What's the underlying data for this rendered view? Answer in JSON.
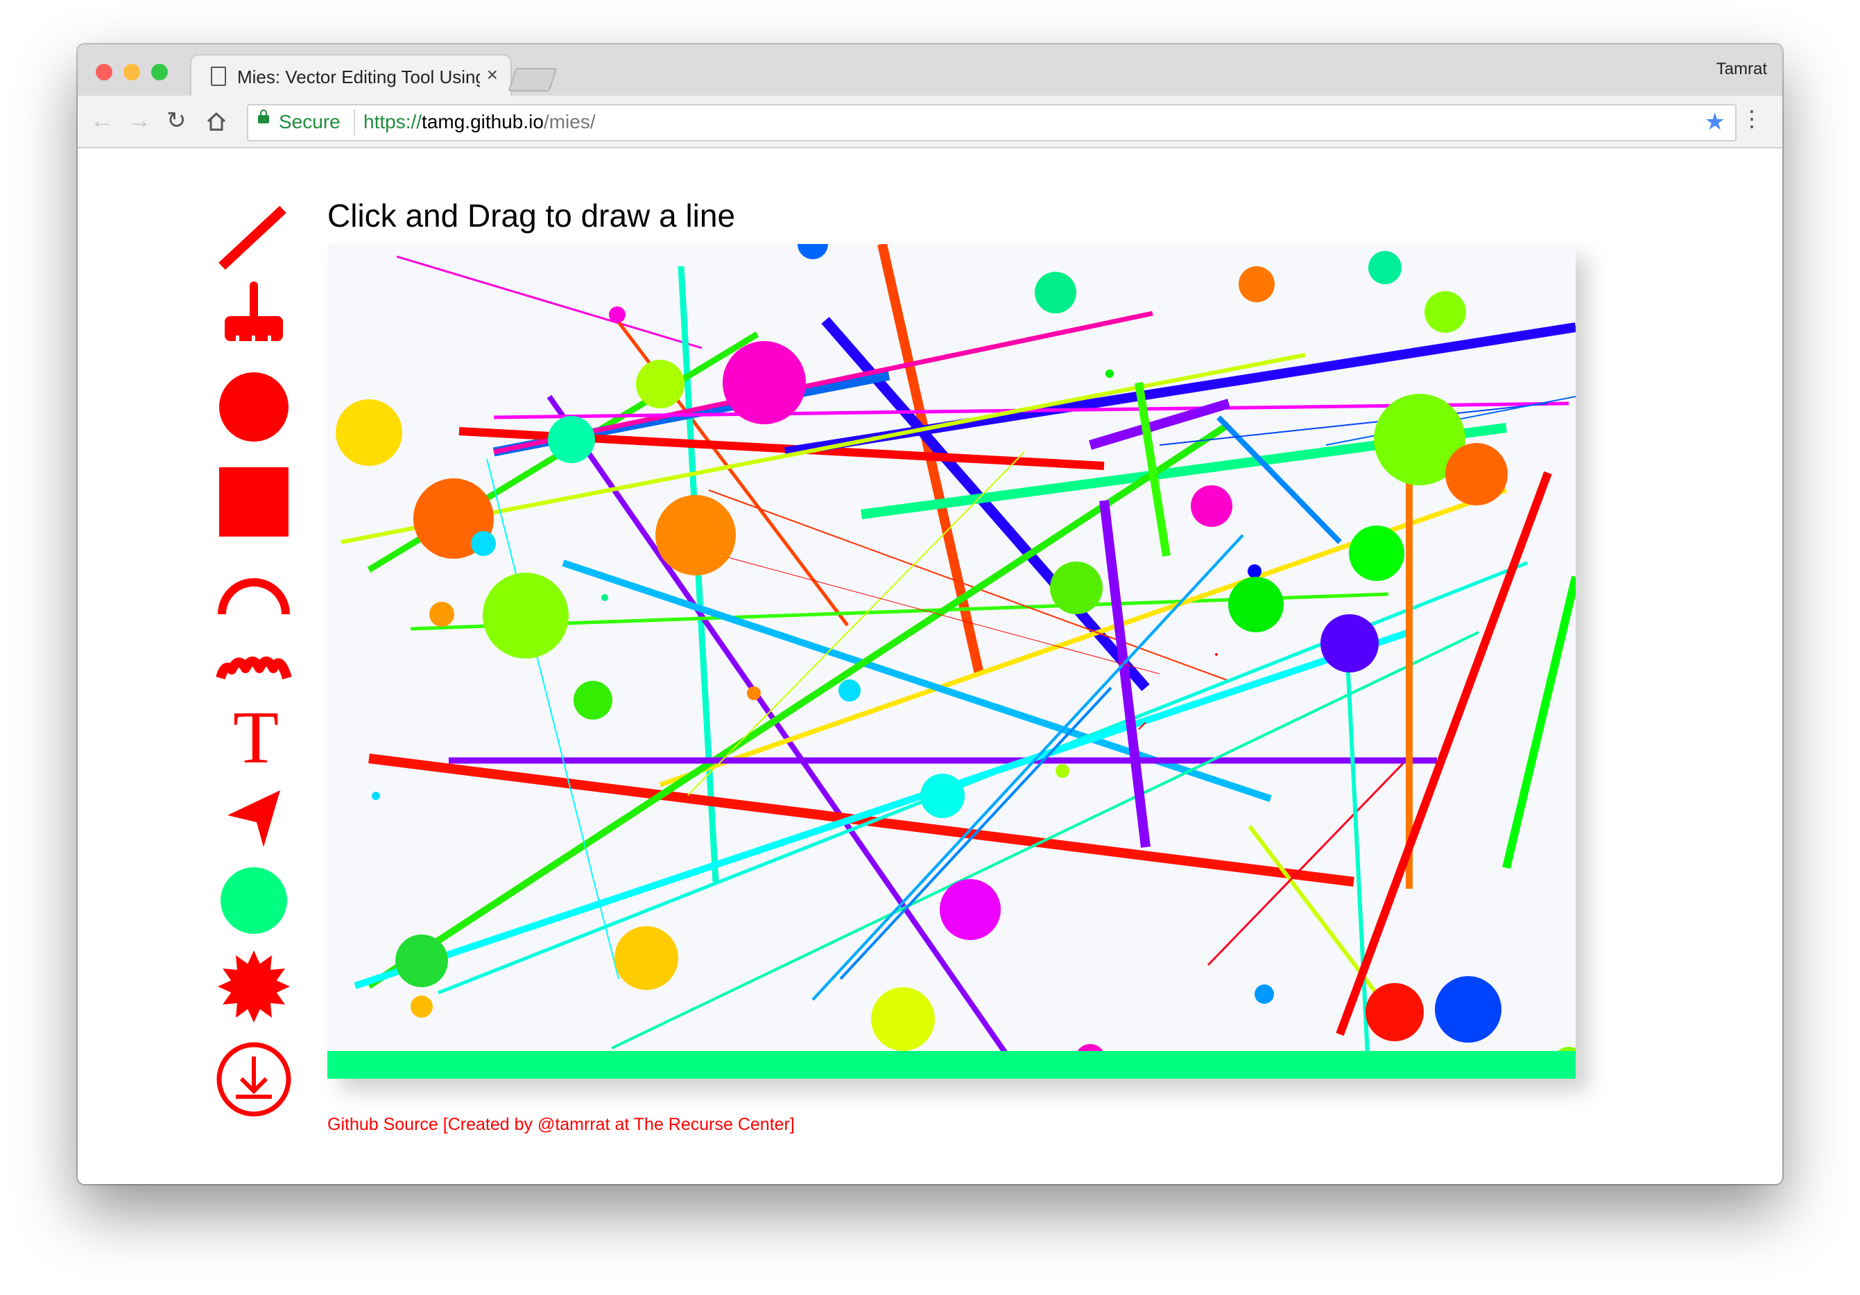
{
  "browser": {
    "tab_title": "Mies: Vector Editing Tool Using",
    "tab_close": "×",
    "user": "Tamrat",
    "secure_label": "Secure",
    "url_scheme": "https://",
    "url_host": "tamg.github.io",
    "url_path": "/mies/"
  },
  "icons": {
    "back": "back-arrow-icon",
    "forward": "forward-arrow-icon",
    "reload": "reload-icon",
    "home": "home-icon",
    "lock": "lock-icon",
    "bookmark": "star-icon",
    "menu": "three-dots-icon"
  },
  "tools": [
    {
      "name": "line-tool",
      "icon": "line-icon"
    },
    {
      "name": "brush-tool",
      "icon": "brush-icon"
    },
    {
      "name": "circle-tool",
      "icon": "circle-icon"
    },
    {
      "name": "rectangle-tool",
      "icon": "square-icon"
    },
    {
      "name": "arc-tool",
      "icon": "arc-icon"
    },
    {
      "name": "wave-tool",
      "icon": "squiggle-icon"
    },
    {
      "name": "text-tool",
      "icon": "text-icon",
      "label": "T"
    },
    {
      "name": "select-tool",
      "icon": "arrow-pointer-icon"
    },
    {
      "name": "fill-color-tool",
      "icon": "filled-circle-icon"
    },
    {
      "name": "random-tool",
      "icon": "starburst-icon"
    },
    {
      "name": "download-tool",
      "icon": "download-icon"
    }
  ],
  "colors": {
    "tool": "#ff0000",
    "fill_swatch": "#00ff80",
    "bottom_bar": "#00ff80",
    "canvas_bg": "#f7f8fc",
    "secure": "#1e8e3e",
    "url_host": "#1e8e3e"
  },
  "main": {
    "instruction": "Click and Drag to draw a line",
    "footer": "Github Source [Created by @tamrrat at The Recurse Center]"
  }
}
